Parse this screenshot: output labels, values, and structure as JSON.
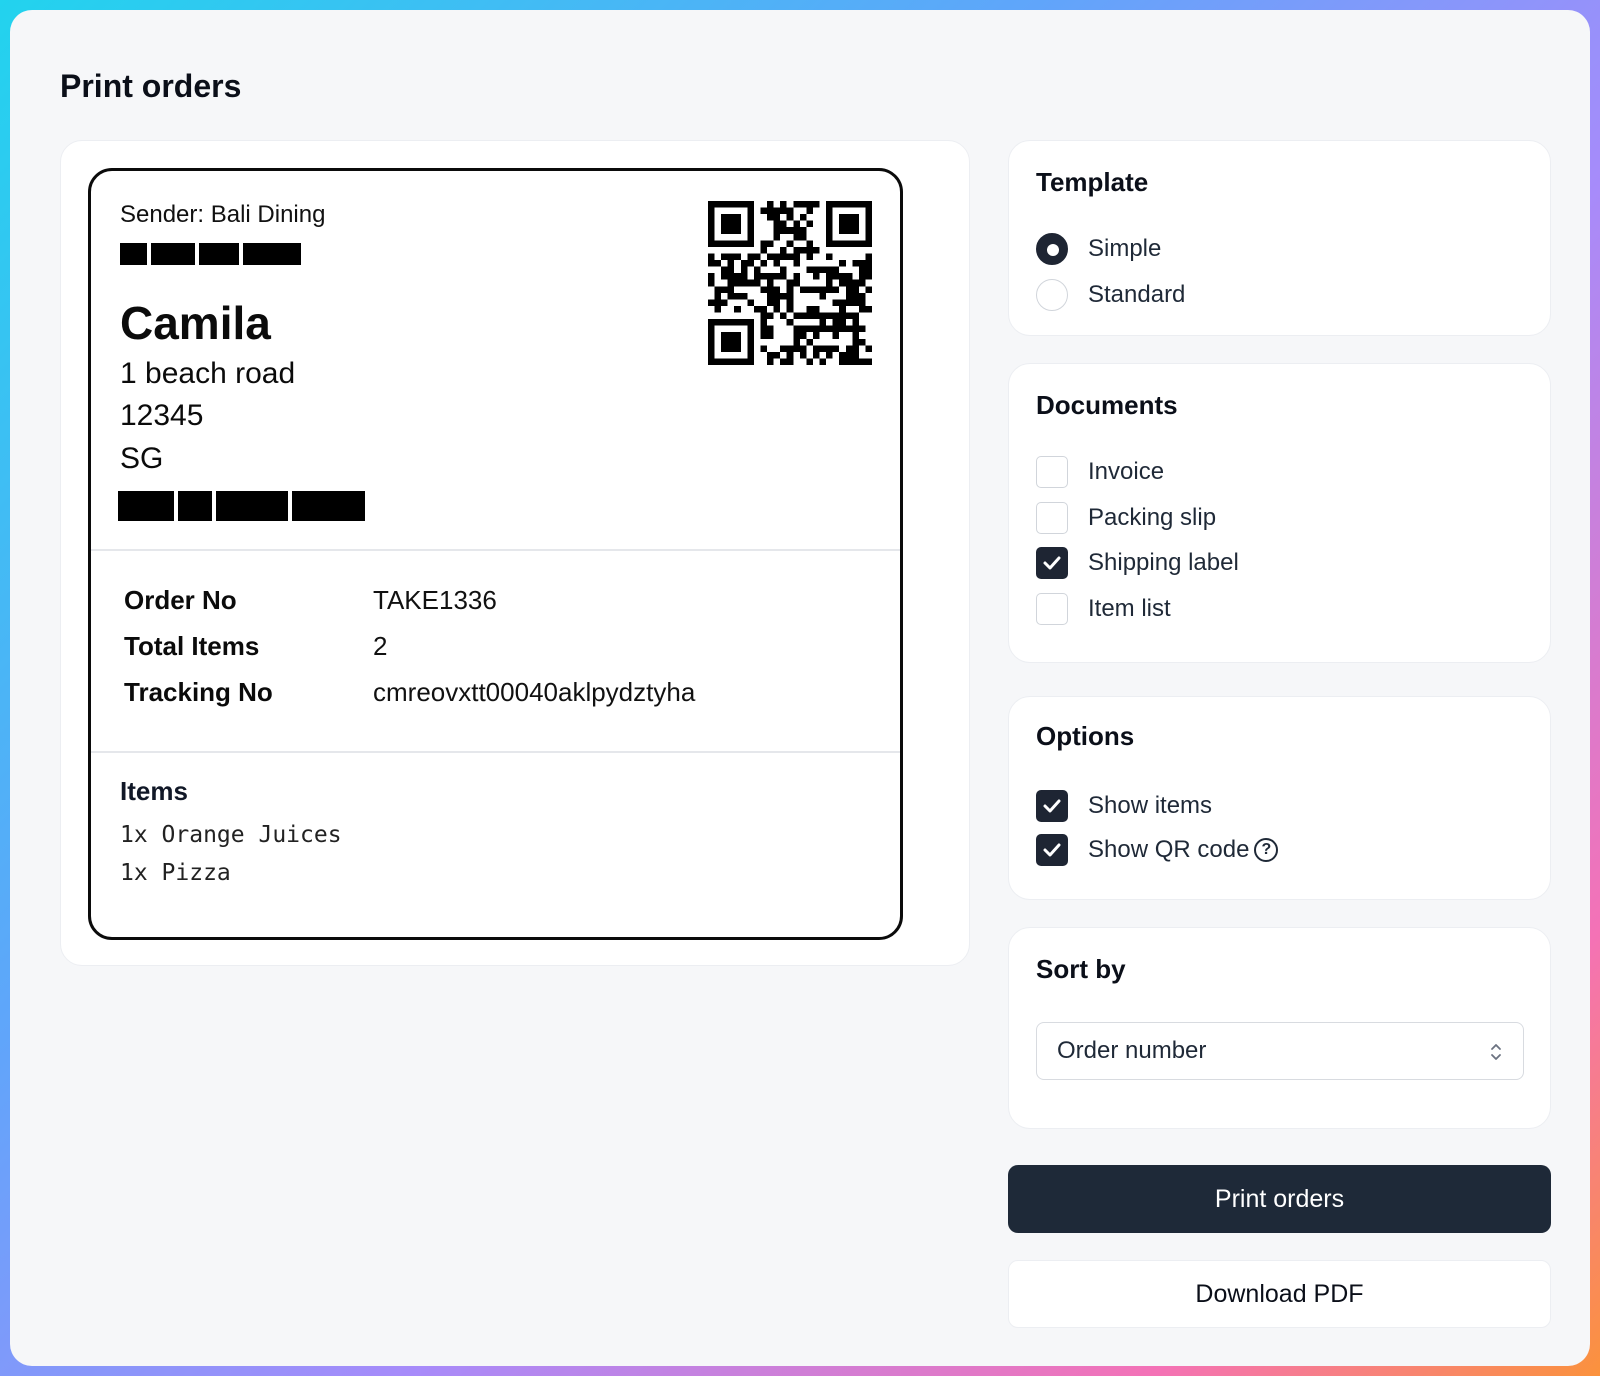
{
  "page": {
    "title": "Print orders"
  },
  "label": {
    "sender": "Sender: Bali Dining",
    "recipient": "Camila",
    "address": [
      "1 beach road",
      "12345",
      "SG"
    ],
    "info": [
      {
        "key": "Order No",
        "value": "TAKE1336"
      },
      {
        "key": "Total Items",
        "value": "2"
      },
      {
        "key": "Tracking No",
        "value": "cmreovxtt00040aklpydztyha"
      }
    ],
    "items_title": "Items",
    "items": [
      "1x Orange Juices",
      "1x Pizza"
    ]
  },
  "template": {
    "title": "Template",
    "options": [
      {
        "label": "Simple",
        "selected": true
      },
      {
        "label": "Standard",
        "selected": false
      }
    ]
  },
  "documents": {
    "title": "Documents",
    "options": [
      {
        "label": "Invoice",
        "checked": false
      },
      {
        "label": "Packing slip",
        "checked": false
      },
      {
        "label": "Shipping label",
        "checked": true
      },
      {
        "label": "Item list",
        "checked": false
      }
    ]
  },
  "options": {
    "title": "Options",
    "items": [
      {
        "label": "Show items",
        "checked": true
      },
      {
        "label": "Show QR code",
        "checked": true,
        "help_icon": "question-circle-icon"
      }
    ],
    "help_glyph": "?"
  },
  "sort": {
    "title": "Sort by",
    "value": "Order number"
  },
  "actions": {
    "print_label": "Print orders",
    "download_label": "Download PDF"
  },
  "colors": {
    "primary": "#1e2938",
    "checked": "#1e2533",
    "background": "#f6f7f9"
  }
}
